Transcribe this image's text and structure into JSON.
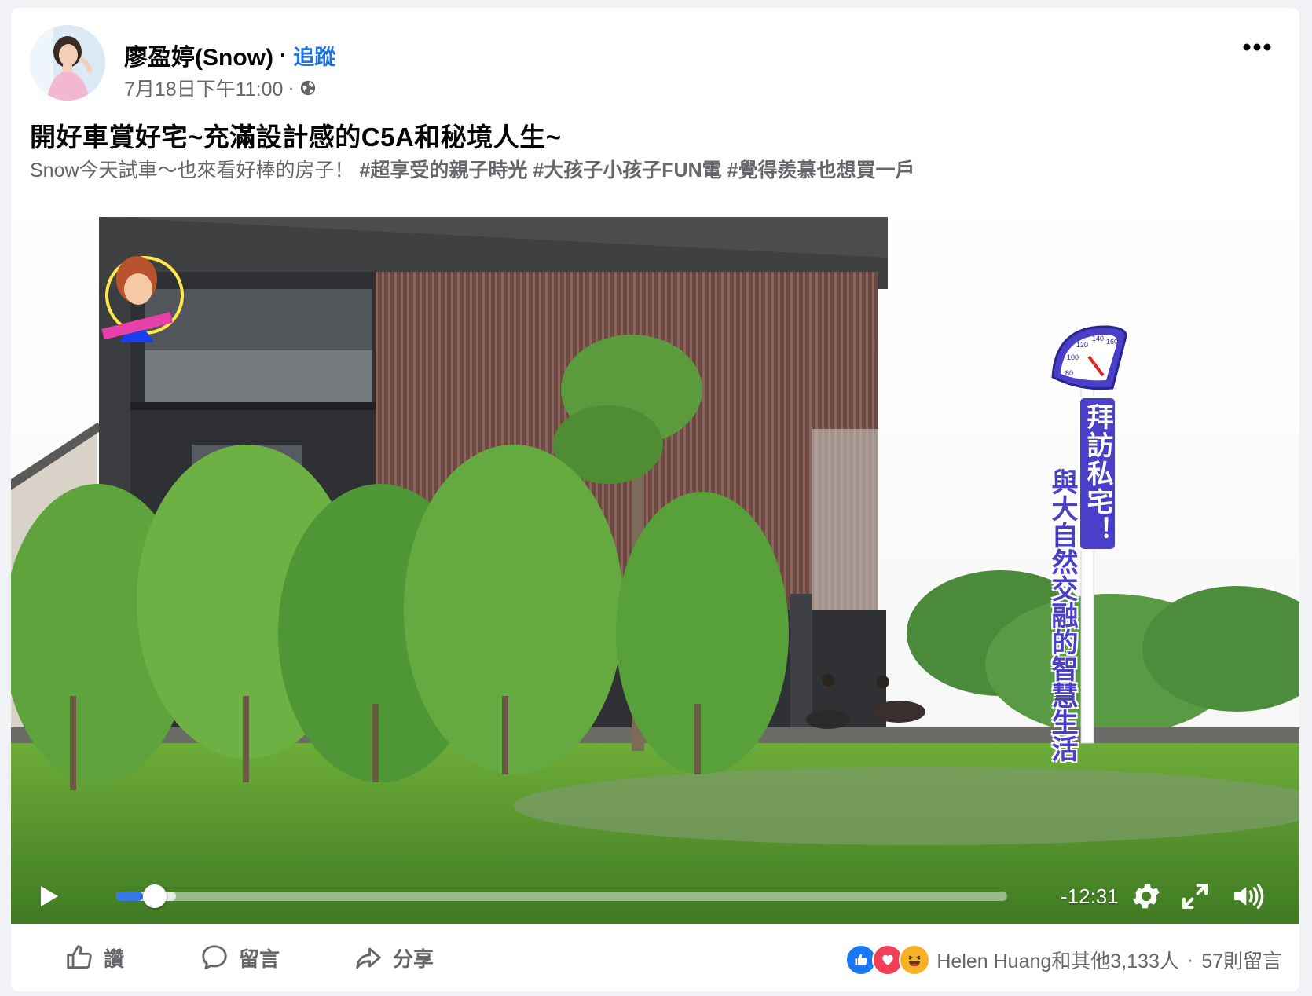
{
  "post": {
    "author": "廖盈婷(Snow)",
    "separator": "·",
    "follow_label": "追蹤",
    "timestamp": "7月18日下午11:00",
    "meta_dot": "·",
    "audience_icon": "globe-icon",
    "more_icon": "more-options-icon",
    "title": "開好車賞好宅~充滿設計感的C5A和秘境人生~",
    "text_intro": "Snow今天試車～也來看好棒的房子！ ",
    "hashtags": [
      "#超享受的親子時光",
      "#大孩子小孩子FUN電",
      "#覺得羨慕也想買一戶"
    ]
  },
  "video": {
    "overlay_caption_1": "拜訪私宅！",
    "overlay_caption_2": "與大自然交融的智慧生活",
    "speedometer_labels": [
      "80",
      "100",
      "120",
      "140",
      "160"
    ],
    "time_remaining": "-12:31",
    "progress_fraction": 0.03,
    "controls": {
      "play_icon": "play-icon",
      "settings_icon": "gear-icon",
      "fullscreen_icon": "fullscreen-icon",
      "volume_icon": "volume-icon"
    }
  },
  "actions": {
    "like_label": "讚",
    "comment_label": "留言",
    "share_label": "分享"
  },
  "reactions": {
    "summary": "Helen Huang和其他3,133人",
    "dot": "·",
    "comments_count": "57則留言",
    "types": [
      "like",
      "love",
      "haha"
    ],
    "colors": {
      "like": "#1877f2",
      "love": "#f33e58",
      "haha": "#f7b125"
    }
  },
  "colors": {
    "link": "#1b74e4",
    "muted": "#65676b",
    "progress": "#3578e5"
  }
}
